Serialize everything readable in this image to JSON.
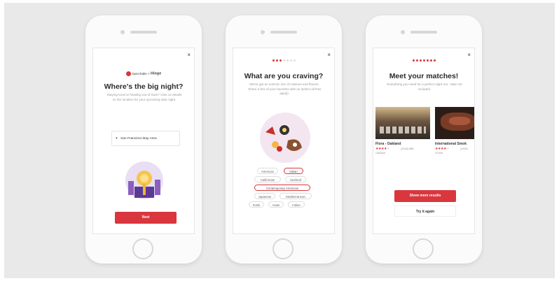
{
  "screen1": {
    "brand_left": "OpenTable",
    "brand_sep": "×",
    "brand_right": "Hinge",
    "title": "Where's the big night?",
    "subtitle": "Staying local or heading out of town? Give us details on the location for your upcoming date night.",
    "location_value": "San Francisco Bay Area",
    "next_label": "Next"
  },
  "screen2": {
    "title": "What are you craving?",
    "subtitle": "We've got an eclectic mix of cuisines and flavors. Share a few of your favorites with us (select all that apply).",
    "progress": {
      "total": 7,
      "active": 3
    },
    "chips": [
      {
        "label": "American",
        "selected": false
      },
      {
        "label": "Italian",
        "selected": true
      },
      {
        "label": "Californian",
        "selected": false
      },
      {
        "label": "Seafood",
        "selected": false
      },
      {
        "label": "Contemporary American",
        "selected": true
      },
      {
        "label": "Japanese",
        "selected": false
      },
      {
        "label": "Mediterranean",
        "selected": false
      },
      {
        "label": "Sushi",
        "selected": false
      },
      {
        "label": "Asian",
        "selected": false
      },
      {
        "label": "Indian",
        "selected": false
      }
    ]
  },
  "screen3": {
    "title": "Meet your matches!",
    "subtitle": "Everything you need for a perfect night out - date not included.",
    "progress": {
      "total": 7,
      "active": 7
    },
    "results": [
      {
        "name": "Flora - Oakland",
        "reviews": "(2538) $$$",
        "area": "Oakland",
        "rating": 4
      },
      {
        "name": "International Smok",
        "reviews": "(2890)",
        "area": "SOMA",
        "rating": 4
      }
    ],
    "show_more_label": "Show more results",
    "try_again_label": "Try it again"
  },
  "icons": {
    "close": "×",
    "pin": "⌖",
    "star_on": "★"
  },
  "colors": {
    "accent": "#d9363e",
    "background": "#e9e9ea"
  }
}
